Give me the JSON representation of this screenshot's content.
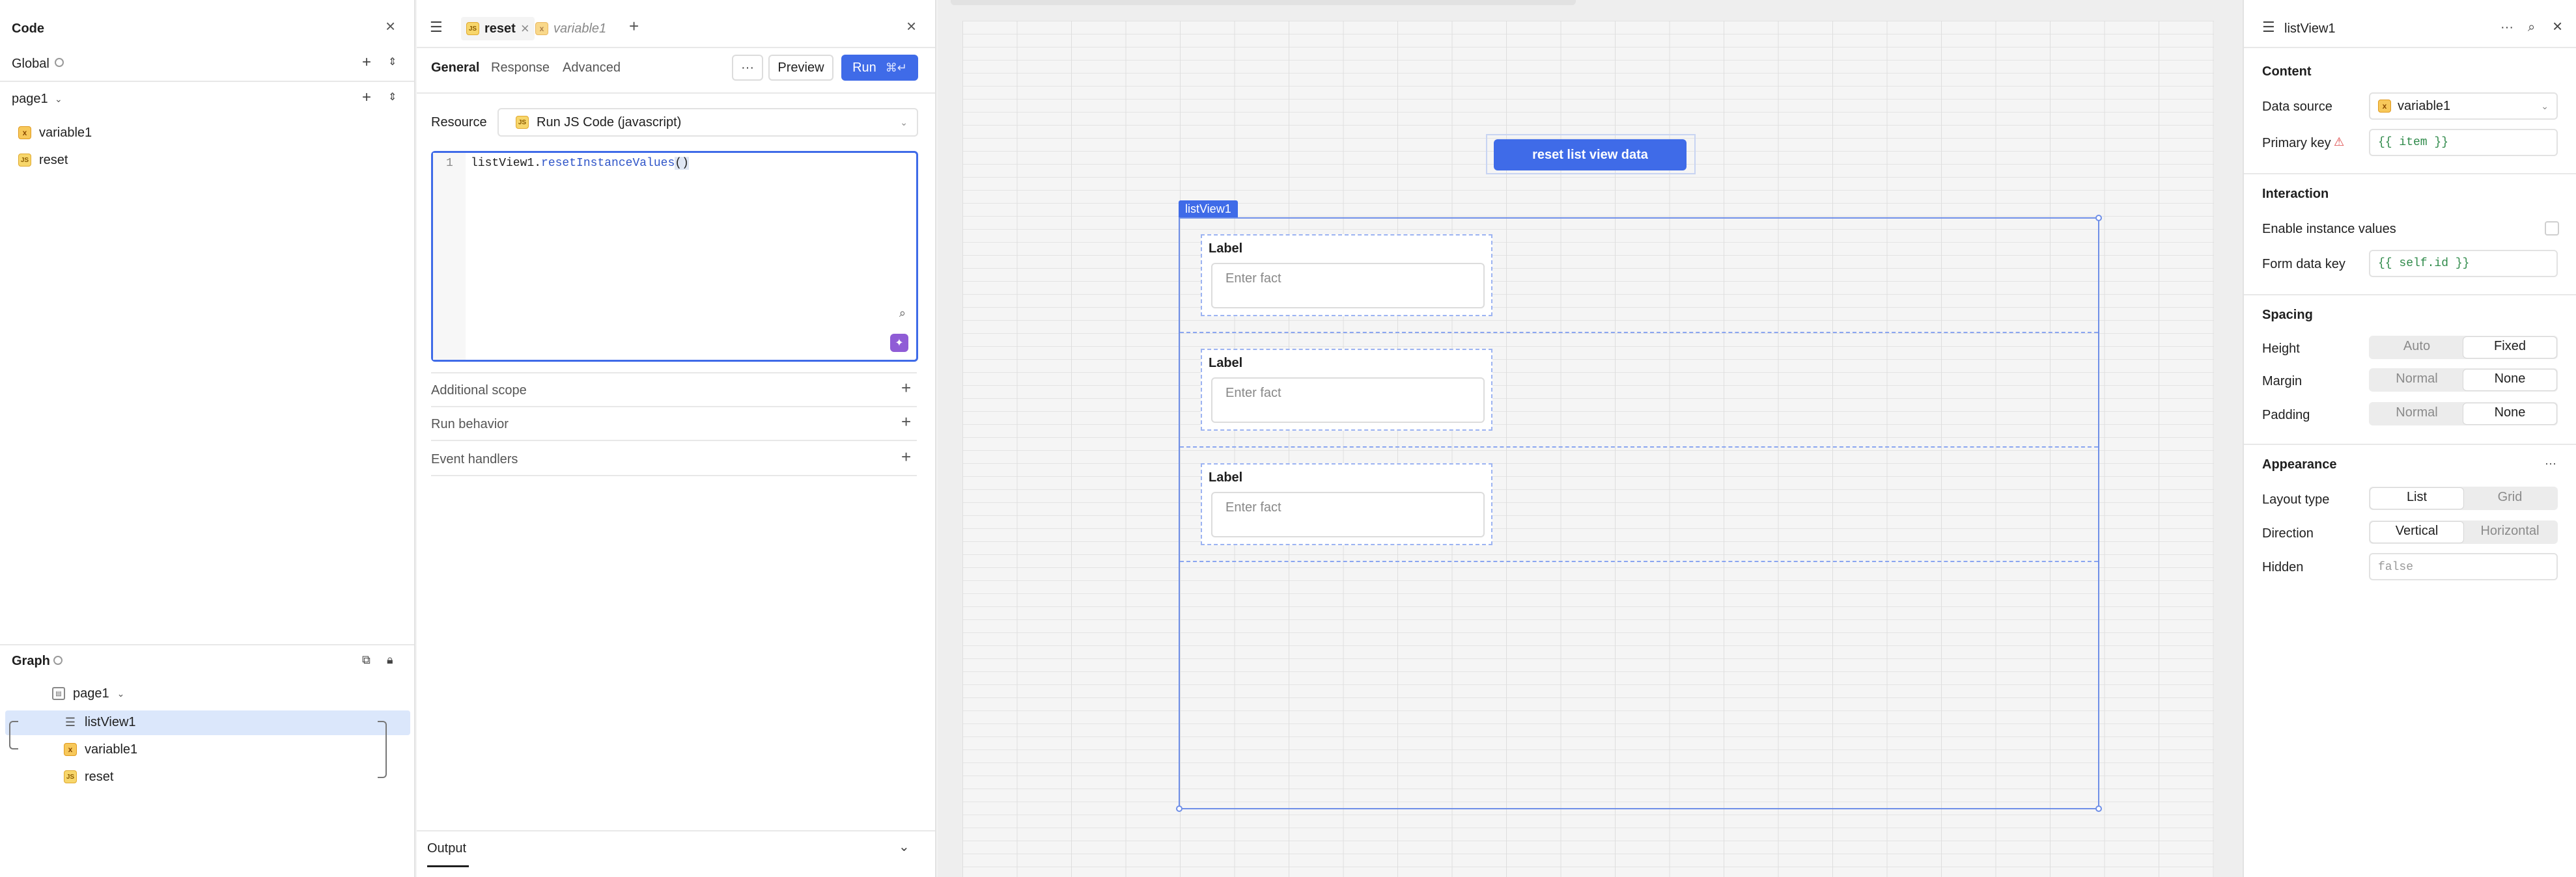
{
  "left": {
    "title": "Code",
    "global_label": "Global",
    "page_label": "page1",
    "items": [
      {
        "label": "variable1",
        "icon": "variable-icon"
      },
      {
        "label": "reset",
        "icon": "js-query-icon"
      }
    ],
    "graph": {
      "title": "Graph",
      "nodes": [
        {
          "label": "page1",
          "icon": "page-icon"
        },
        {
          "label": "listView1",
          "icon": "list-icon"
        },
        {
          "label": "variable1",
          "icon": "variable-icon"
        },
        {
          "label": "reset",
          "icon": "js-query-icon"
        }
      ]
    }
  },
  "editor": {
    "tabs": [
      {
        "label": "reset",
        "active": true
      },
      {
        "label": "variable1",
        "active": false
      }
    ],
    "subtabs": [
      "General",
      "Response",
      "Advanced"
    ],
    "preview_label": "Preview",
    "run_label": "Run",
    "run_shortcut": "⌘↵",
    "resource_label": "Resource",
    "resource_value": "Run JS Code (javascript)",
    "code": {
      "line_number": "1",
      "obj": "listView1",
      "dot": ".",
      "method": "resetInstanceValues",
      "parens": "()"
    },
    "sections": [
      "Additional scope",
      "Run behavior",
      "Event handlers"
    ],
    "output_label": "Output"
  },
  "canvas": {
    "button_label": "reset list view data",
    "listview_tag": "listView1",
    "rows": [
      {
        "label": "Label",
        "placeholder": "Enter fact"
      },
      {
        "label": "Label",
        "placeholder": "Enter fact"
      },
      {
        "label": "Label",
        "placeholder": "Enter fact"
      }
    ]
  },
  "inspector": {
    "title": "listView1",
    "content_heading": "Content",
    "data_source_label": "Data source",
    "data_source_value": "variable1",
    "primary_key_label": "Primary key",
    "primary_key_value": "{{ item }}",
    "interaction_heading": "Interaction",
    "enable_instance_label": "Enable instance values",
    "form_data_key_label": "Form data key",
    "form_data_key_value": "{{ self.id }}",
    "spacing_heading": "Spacing",
    "height_label": "Height",
    "height_options": [
      "Auto",
      "Fixed"
    ],
    "height_selected": "Fixed",
    "margin_label": "Margin",
    "margin_options": [
      "Normal",
      "None"
    ],
    "margin_selected": "None",
    "padding_label": "Padding",
    "padding_options": [
      "Normal",
      "None"
    ],
    "padding_selected": "None",
    "appearance_heading": "Appearance",
    "layout_label": "Layout type",
    "layout_options": [
      "List",
      "Grid"
    ],
    "layout_selected": "List",
    "direction_label": "Direction",
    "direction_options": [
      "Vertical",
      "Horizontal"
    ],
    "direction_selected": "Vertical",
    "hidden_label": "Hidden",
    "hidden_value": "false"
  },
  "colors": {
    "accent": "#3f6be8",
    "selection": "#dbe7fb"
  }
}
